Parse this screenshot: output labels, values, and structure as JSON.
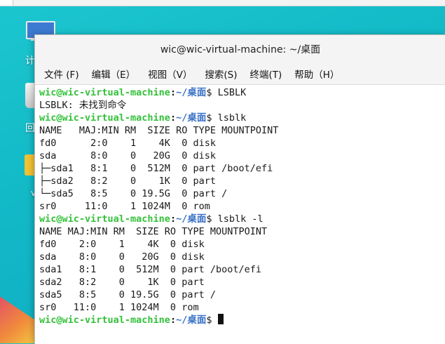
{
  "window": {
    "title": "wic@wic-virtual-machine: ~/桌面"
  },
  "menu": [
    "文件 (F)",
    "编辑（E）",
    "视图（V）",
    "搜索(S)",
    "终端(T)",
    "帮助（H）"
  ],
  "desktop": {
    "labels": [
      "计",
      "回",
      "v"
    ]
  },
  "prompt": {
    "user_host": "wic@wic-virtual-machine",
    "colon": ":",
    "path": "~/桌面",
    "symbol": "$"
  },
  "terminal": {
    "commands": [
      "LSBLK",
      "lsblk",
      "lsblk -l"
    ],
    "output1": [
      "LSBLK: 未找到命令"
    ],
    "output2": [
      "NAME   MAJ:MIN RM  SIZE RO TYPE MOUNTPOINT",
      "fd0      2:0    1    4K  0 disk ",
      "sda      8:0    0   20G  0 disk ",
      "├─sda1   8:1    0  512M  0 part /boot/efi",
      "├─sda2   8:2    0    1K  0 part ",
      "└─sda5   8:5    0 19.5G  0 part /",
      "sr0     11:0    1 1024M  0 rom  "
    ],
    "output3": [
      "NAME MAJ:MIN RM  SIZE RO TYPE MOUNTPOINT",
      "fd0    2:0    1    4K  0 disk ",
      "sda    8:0    0   20G  0 disk ",
      "sda1   8:1    0  512M  0 part /boot/efi",
      "sda2   8:2    0    1K  0 part ",
      "sda5   8:5    0 19.5G  0 part /",
      "sr0   11:0    1 1024M  0 rom  "
    ]
  }
}
